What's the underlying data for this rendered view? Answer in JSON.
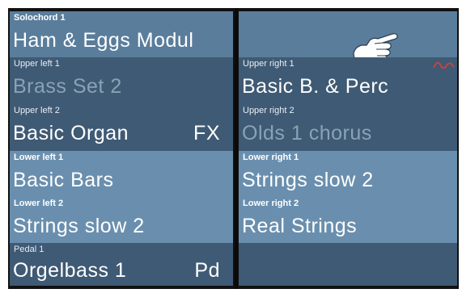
{
  "left": {
    "solochord": {
      "label": "Solochord 1",
      "value": "Ham & Eggs Modul"
    },
    "upper_left_1": {
      "label": "Upper left 1",
      "value": "Brass Set 2"
    },
    "upper_left_2": {
      "label": "Upper left 2",
      "value": "Basic Organ",
      "suffix": "FX"
    },
    "lower_left_1": {
      "label": "Lower left 1",
      "value": "Basic Bars"
    },
    "lower_left_2": {
      "label": "Lower left 2",
      "value": "Strings slow 2"
    },
    "pedal_1": {
      "label": "Pedal 1",
      "value": "Orgelbass 1",
      "suffix": "Pd"
    }
  },
  "right": {
    "upper_right_1": {
      "label": "Upper right 1",
      "value": "Basic B. & Perc"
    },
    "upper_right_2": {
      "label": "Upper right 2",
      "value": "Olds 1 chorus"
    },
    "lower_right_1": {
      "label": "Lower right 1",
      "value": "Strings slow 2"
    },
    "lower_right_2": {
      "label": "Lower right 2",
      "value": "Real Strings"
    }
  },
  "icons": {
    "pointer": "hand-pointer-icon",
    "wave": "wave-indicator-icon"
  },
  "colors": {
    "accent_wave": "#d6403a",
    "inactive_text": "#8aa2b8"
  }
}
